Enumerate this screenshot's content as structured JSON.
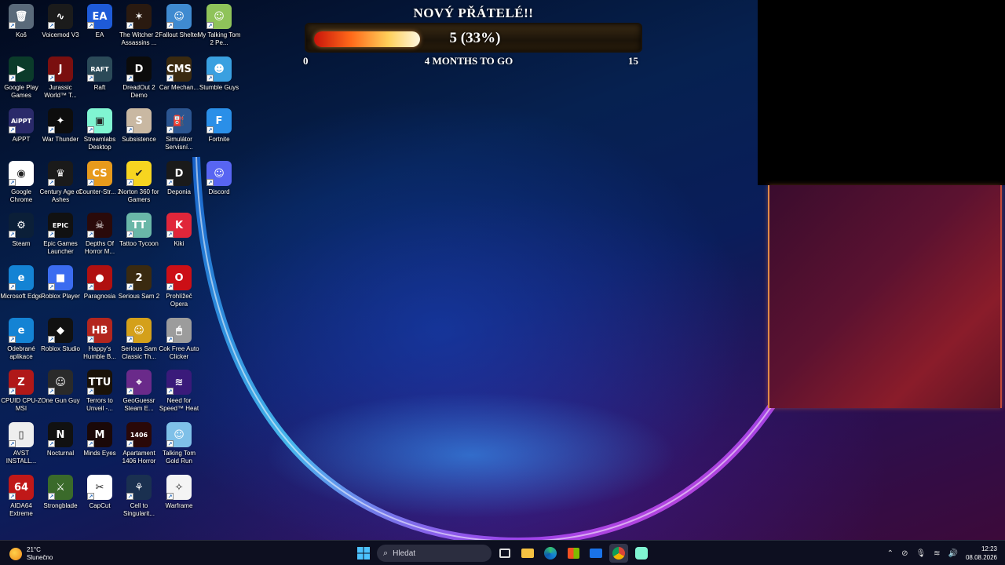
{
  "desktop": {
    "icons": [
      {
        "label": "Koš",
        "icon": "recycle-bin-icon",
        "color": "#5a6a7a",
        "glyph": "🗑"
      },
      {
        "label": "Voicemod V3",
        "icon": "voicemod-icon",
        "color": "#1b1b1b",
        "glyph": "∿"
      },
      {
        "label": "EA",
        "icon": "ea-icon",
        "color": "#1e5bd8",
        "glyph": "EA"
      },
      {
        "label": "The Witcher 2 Assassins ...",
        "icon": "witcher-icon",
        "color": "#2a1a10",
        "glyph": "✶"
      },
      {
        "label": "Fallout Shelter",
        "icon": "fallout-shelter-icon",
        "color": "#3f8ad0",
        "glyph": "☺"
      },
      {
        "label": "My Talking Tom 2 Pe...",
        "icon": "talking-tom-icon",
        "color": "#8fc35a",
        "glyph": "☺"
      },
      {
        "label": "Google Play Games",
        "icon": "google-play-games-icon",
        "color": "#0b3b2a",
        "glyph": "▶"
      },
      {
        "label": "Jurassic World™ T...",
        "icon": "jurassic-world-icon",
        "color": "#7a0f0f",
        "glyph": "J"
      },
      {
        "label": "Raft",
        "icon": "raft-icon",
        "color": "#2b4a58",
        "glyph": "RAFT"
      },
      {
        "label": "DreadOut 2 Demo",
        "icon": "dreadout-icon",
        "color": "#0b0b0b",
        "glyph": "D"
      },
      {
        "label": "Car Mechan...",
        "icon": "car-mechanic-icon",
        "color": "#3a2a10",
        "glyph": "CMS"
      },
      {
        "label": "Stumble Guys",
        "icon": "stumble-guys-icon",
        "color": "#3aa0e0",
        "glyph": "☻"
      },
      {
        "label": "AiPPT",
        "icon": "aippt-icon",
        "color": "#2a2a6a",
        "glyph": "AiPPT"
      },
      {
        "label": "War Thunder",
        "icon": "war-thunder-icon",
        "color": "#0d0d0d",
        "glyph": "✦"
      },
      {
        "label": "Streamlabs Desktop",
        "icon": "streamlabs-icon",
        "color": "#80f5d2",
        "glyph": "▣"
      },
      {
        "label": "Subsistence",
        "icon": "subsistence-icon",
        "color": "#c9b8a2",
        "glyph": "S"
      },
      {
        "label": "Simulátor Servisní...",
        "icon": "service-area-simulator-icon",
        "color": "#2b5590",
        "glyph": "⛽"
      },
      {
        "label": "Fortnite",
        "icon": "fortnite-icon",
        "color": "#2a8fe8",
        "glyph": "F"
      },
      {
        "label": "Google Chrome",
        "icon": "chrome-icon",
        "color": "#ffffff",
        "glyph": "◉"
      },
      {
        "label": "Century Age of Ashes",
        "icon": "century-icon",
        "color": "#1a1a1a",
        "glyph": "♛"
      },
      {
        "label": "Counter-Str... 2",
        "icon": "counter-strike-icon",
        "color": "#e79a1c",
        "glyph": "CS"
      },
      {
        "label": "Norton 360 for Gamers",
        "icon": "norton-icon",
        "color": "#f7d520",
        "glyph": "✔"
      },
      {
        "label": "Deponia",
        "icon": "deponia-icon",
        "color": "#1a1a1a",
        "glyph": "D"
      },
      {
        "label": "Discord",
        "icon": "discord-icon",
        "color": "#5865f2",
        "glyph": "☺"
      },
      {
        "label": "Steam",
        "icon": "steam-icon",
        "color": "#0b1f38",
        "glyph": "⚙"
      },
      {
        "label": "Epic Games Launcher",
        "icon": "epic-games-icon",
        "color": "#111111",
        "glyph": "EPIC"
      },
      {
        "label": "Depths Of Horror M...",
        "icon": "depths-of-horror-icon",
        "color": "#2a0a0a",
        "glyph": "☠"
      },
      {
        "label": "Tattoo Tycoon",
        "icon": "tattoo-tycoon-icon",
        "color": "#6ab7a8",
        "glyph": "TT"
      },
      {
        "label": "Kiki",
        "icon": "kiki-icon",
        "color": "#e0263a",
        "glyph": "K"
      },
      null,
      {
        "label": "Microsoft Edge",
        "icon": "edge-icon",
        "color": "#1483d4",
        "glyph": "e"
      },
      {
        "label": "Roblox Player",
        "icon": "roblox-player-icon",
        "color": "#3b6cf0",
        "glyph": "■"
      },
      {
        "label": "Paragnosia",
        "icon": "paragnosia-icon",
        "color": "#b01010",
        "glyph": "●"
      },
      {
        "label": "Serious Sam 2",
        "icon": "serious-sam-2-icon",
        "color": "#3a2a10",
        "glyph": "2"
      },
      {
        "label": "Prohlížeč Opera",
        "icon": "opera-icon",
        "color": "#cc0f16",
        "glyph": "O"
      },
      null,
      {
        "label": "Odebrané aplikace",
        "icon": "removed-apps-edge-icon",
        "color": "#1483d4",
        "glyph": "e"
      },
      {
        "label": "Roblox Studio",
        "icon": "roblox-studio-icon",
        "color": "#111111",
        "glyph": "◆"
      },
      {
        "label": "Happy's Humble B...",
        "icon": "humble-bundle-icon",
        "color": "#b3261e",
        "glyph": "HB"
      },
      {
        "label": "Serious Sam Classic Th...",
        "icon": "serious-sam-classic-icon",
        "color": "#d4a01a",
        "glyph": "☺"
      },
      {
        "label": "Cok Free Auto Clicker",
        "icon": "auto-clicker-icon",
        "color": "#9c9c9c",
        "glyph": "🖱"
      },
      null,
      {
        "label": "CPUID CPU-Z MSI",
        "icon": "cpu-z-icon",
        "color": "#b01818",
        "glyph": "Z"
      },
      {
        "label": "One Gun Guy",
        "icon": "one-gun-guy-icon",
        "color": "#2a2a2a",
        "glyph": "☺"
      },
      {
        "label": "Terrors to Unveil -...",
        "icon": "terrors-to-unveil-icon",
        "color": "#1a1208",
        "glyph": "TTU"
      },
      {
        "label": "GeoGuessr Steam E...",
        "icon": "geoguessr-icon",
        "color": "#6a2a8a",
        "glyph": "⌖"
      },
      {
        "label": "Need for Speed™ Heat",
        "icon": "nfs-heat-icon",
        "color": "#3a1a7a",
        "glyph": "≋"
      },
      null,
      {
        "label": "AVST INSTALL...",
        "icon": "file-icon",
        "color": "#eeeeee",
        "glyph": "▯"
      },
      {
        "label": "Nocturnal",
        "icon": "nocturnal-icon",
        "color": "#111111",
        "glyph": "N"
      },
      {
        "label": "Minds Eyes",
        "icon": "minds-eyes-icon",
        "color": "#1a0808",
        "glyph": "M"
      },
      {
        "label": "Apartament 1406 Horror",
        "icon": "apartament-1406-icon",
        "color": "#2a0808",
        "glyph": "1406"
      },
      {
        "label": "Talking Tom Gold Run",
        "icon": "talking-tom-gold-run-icon",
        "color": "#7fc0e8",
        "glyph": "☺"
      },
      null,
      {
        "label": "AIDA64 Extreme",
        "icon": "aida64-icon",
        "color": "#c01818",
        "glyph": "64"
      },
      {
        "label": "Strongblade",
        "icon": "strongblade-icon",
        "color": "#3a6a2a",
        "glyph": "⚔"
      },
      {
        "label": "CapCut",
        "icon": "capcut-icon",
        "color": "#ffffff",
        "glyph": "✂"
      },
      {
        "label": "Cell to Singularit...",
        "icon": "cell-to-singularity-icon",
        "color": "#1a3050",
        "glyph": "⚘"
      },
      {
        "label": "Warframe",
        "icon": "warframe-icon",
        "color": "#f4f4f4",
        "glyph": "✧"
      },
      null
    ]
  },
  "goal_widget": {
    "title": "NOVÝ PŘÁTELÉ!!",
    "value_text": "5 (33%)",
    "progress_fraction": 0.33,
    "min_label": "0",
    "remaining_label": "4 MONTHS TO GO",
    "max_label": "15"
  },
  "taskbar": {
    "weather_temp": "21°C",
    "weather_desc": "Slunečno",
    "search_placeholder": "Hledat",
    "time": "12:23",
    "date": "08.08.2026",
    "apps": [
      "start-icon",
      "task-view-icon",
      "file-explorer-icon",
      "edge-icon",
      "store-icon",
      "mail-icon",
      "chrome-icon",
      "streamlabs-icon"
    ]
  }
}
